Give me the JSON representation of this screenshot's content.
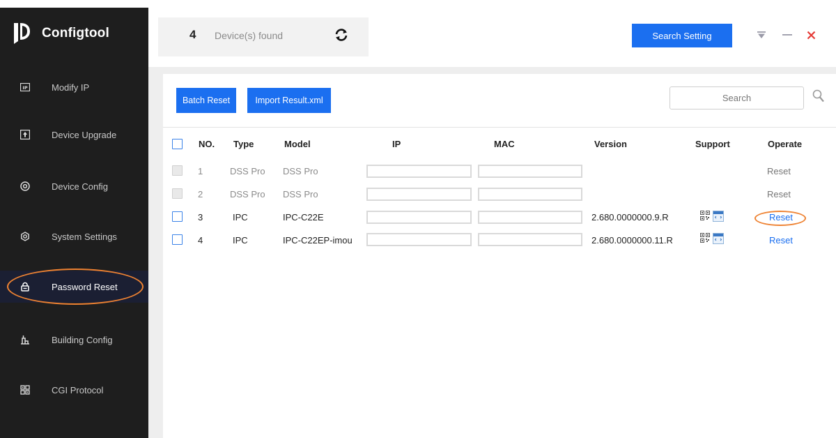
{
  "app": {
    "title": "Configtool"
  },
  "sidebar": {
    "items": [
      {
        "label": "Modify IP",
        "icon": "ip-icon"
      },
      {
        "label": "Device Upgrade",
        "icon": "upload-icon"
      },
      {
        "label": "Device Config",
        "icon": "target-icon"
      },
      {
        "label": "System Settings",
        "icon": "settings-icon"
      },
      {
        "label": "Password Reset",
        "icon": "lock-icon",
        "active": true
      },
      {
        "label": "Building Config",
        "icon": "building-icon"
      },
      {
        "label": "CGI Protocol",
        "icon": "grid-icon"
      }
    ]
  },
  "header": {
    "device_count": "4",
    "device_label": "Device(s) found",
    "search_setting_label": "Search Setting"
  },
  "toolbar": {
    "batch_reset_label": "Batch Reset",
    "import_label": "Import Result.xml",
    "search_placeholder": "Search"
  },
  "table": {
    "columns": [
      "NO.",
      "Type",
      "Model",
      "IP",
      "MAC",
      "Version",
      "Support",
      "Operate"
    ],
    "rows": [
      {
        "no": "1",
        "type": "DSS Pro",
        "model": "DSS Pro",
        "ip": "",
        "mac": "",
        "version": "",
        "operate": "Reset",
        "enabled": false
      },
      {
        "no": "2",
        "type": "DSS Pro",
        "model": "DSS Pro",
        "ip": "",
        "mac": "",
        "version": "",
        "operate": "Reset",
        "enabled": false
      },
      {
        "no": "3",
        "type": "IPC",
        "model": "IPC-C22E",
        "ip": "",
        "mac": "",
        "version": "2.680.0000000.9.R",
        "operate": "Reset",
        "enabled": true
      },
      {
        "no": "4",
        "type": "IPC",
        "model": "IPC-C22EP-imou",
        "ip": "",
        "mac": "",
        "version": "2.680.0000000.11.R",
        "operate": "Reset",
        "enabled": true
      }
    ]
  },
  "colors": {
    "accent": "#1b6ff0",
    "sidebar_bg": "#1e1e1e",
    "highlight_oval": "#ee8232",
    "close": "#e53935"
  }
}
